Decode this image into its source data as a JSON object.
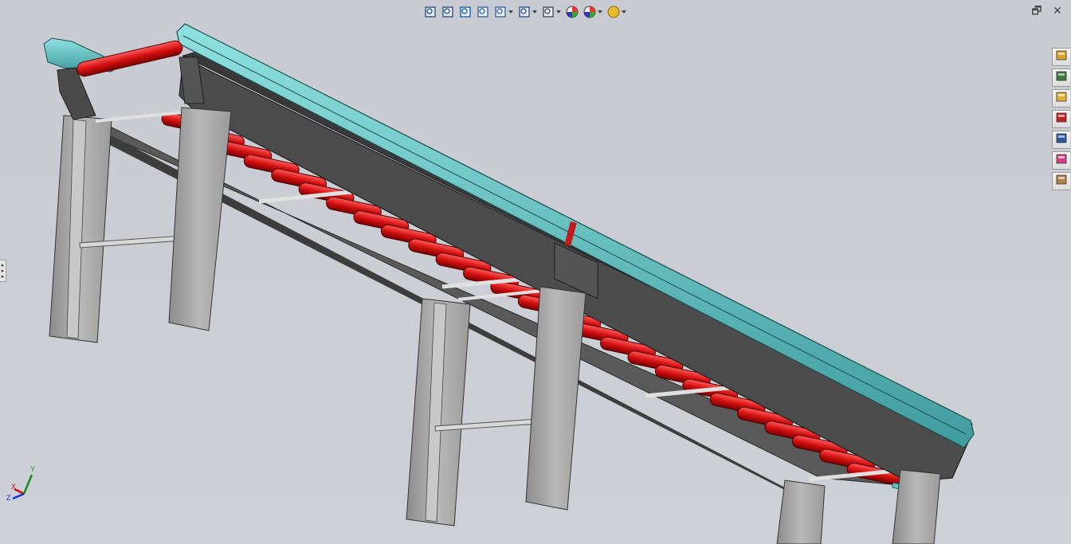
{
  "view_toolbar": {
    "buttons": [
      {
        "name": "zoom-to-fit-icon",
        "dropdown": false
      },
      {
        "name": "zoom-to-area-icon",
        "dropdown": false
      },
      {
        "name": "previous-view-icon",
        "dropdown": false
      },
      {
        "name": "section-view-icon",
        "dropdown": false
      },
      {
        "name": "view-orientation-icon",
        "dropdown": true
      },
      {
        "name": "display-style-icon",
        "dropdown": true
      },
      {
        "name": "hide-show-items-icon",
        "dropdown": true
      },
      {
        "name": "edit-appearance-icon",
        "dropdown": false
      },
      {
        "name": "apply-scene-icon",
        "dropdown": true
      },
      {
        "name": "view-settings-icon",
        "dropdown": true
      }
    ]
  },
  "window_controls": {
    "restore": "🗗",
    "close": "✕"
  },
  "task_pane": {
    "tabs": [
      "home-icon",
      "design-library-icon",
      "file-explorer-icon",
      "view-palette-icon",
      "custom-properties-icon",
      "appearances-icon",
      "document-recovery-icon"
    ]
  },
  "triad": {
    "x": "X",
    "y": "Y",
    "z": "Z"
  },
  "colors": {
    "background": "#c9ccd3",
    "frame": "#4a4a4a",
    "guide_rail": "#62c2c4",
    "roller": "#d81414",
    "leg": "#a9a9a9"
  }
}
